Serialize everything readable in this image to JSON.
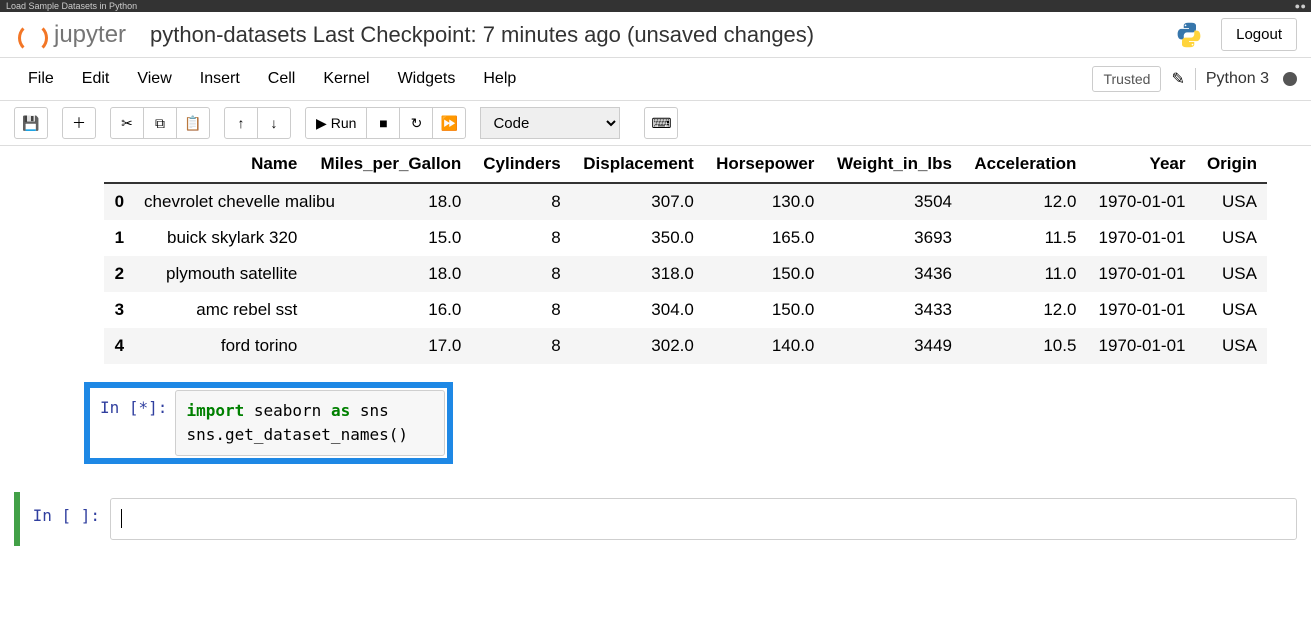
{
  "browser": {
    "tab_title": "Load Sample Datasets in Python"
  },
  "header": {
    "logo_text": "jupyter",
    "notebook_title": "python-datasets Last Checkpoint: 7 minutes ago  (unsaved changes)",
    "logout": "Logout"
  },
  "menu": {
    "items": [
      "File",
      "Edit",
      "View",
      "Insert",
      "Cell",
      "Kernel",
      "Widgets",
      "Help"
    ],
    "trusted": "Trusted",
    "kernel": "Python 3"
  },
  "toolbar": {
    "run_label": "Run",
    "cell_type": "Code"
  },
  "table": {
    "columns": [
      "Name",
      "Miles_per_Gallon",
      "Cylinders",
      "Displacement",
      "Horsepower",
      "Weight_in_lbs",
      "Acceleration",
      "Year",
      "Origin"
    ],
    "rows": [
      {
        "idx": "0",
        "Name": "chevrolet chevelle malibu",
        "Miles_per_Gallon": "18.0",
        "Cylinders": "8",
        "Displacement": "307.0",
        "Horsepower": "130.0",
        "Weight_in_lbs": "3504",
        "Acceleration": "12.0",
        "Year": "1970-01-01",
        "Origin": "USA"
      },
      {
        "idx": "1",
        "Name": "buick skylark 320",
        "Miles_per_Gallon": "15.0",
        "Cylinders": "8",
        "Displacement": "350.0",
        "Horsepower": "165.0",
        "Weight_in_lbs": "3693",
        "Acceleration": "11.5",
        "Year": "1970-01-01",
        "Origin": "USA"
      },
      {
        "idx": "2",
        "Name": "plymouth satellite",
        "Miles_per_Gallon": "18.0",
        "Cylinders": "8",
        "Displacement": "318.0",
        "Horsepower": "150.0",
        "Weight_in_lbs": "3436",
        "Acceleration": "11.0",
        "Year": "1970-01-01",
        "Origin": "USA"
      },
      {
        "idx": "3",
        "Name": "amc rebel sst",
        "Miles_per_Gallon": "16.0",
        "Cylinders": "8",
        "Displacement": "304.0",
        "Horsepower": "150.0",
        "Weight_in_lbs": "3433",
        "Acceleration": "12.0",
        "Year": "1970-01-01",
        "Origin": "USA"
      },
      {
        "idx": "4",
        "Name": "ford torino",
        "Miles_per_Gallon": "17.0",
        "Cylinders": "8",
        "Displacement": "302.0",
        "Horsepower": "140.0",
        "Weight_in_lbs": "3449",
        "Acceleration": "10.5",
        "Year": "1970-01-01",
        "Origin": "USA"
      }
    ]
  },
  "cells": {
    "running": {
      "prompt": "In [*]:",
      "code_line1_kw1": "import",
      "code_line1_rest": " seaborn ",
      "code_line1_kw2": "as",
      "code_line1_rest2": " sns",
      "code_line2": "sns.get_dataset_names()"
    },
    "empty": {
      "prompt": "In [ ]:"
    }
  }
}
